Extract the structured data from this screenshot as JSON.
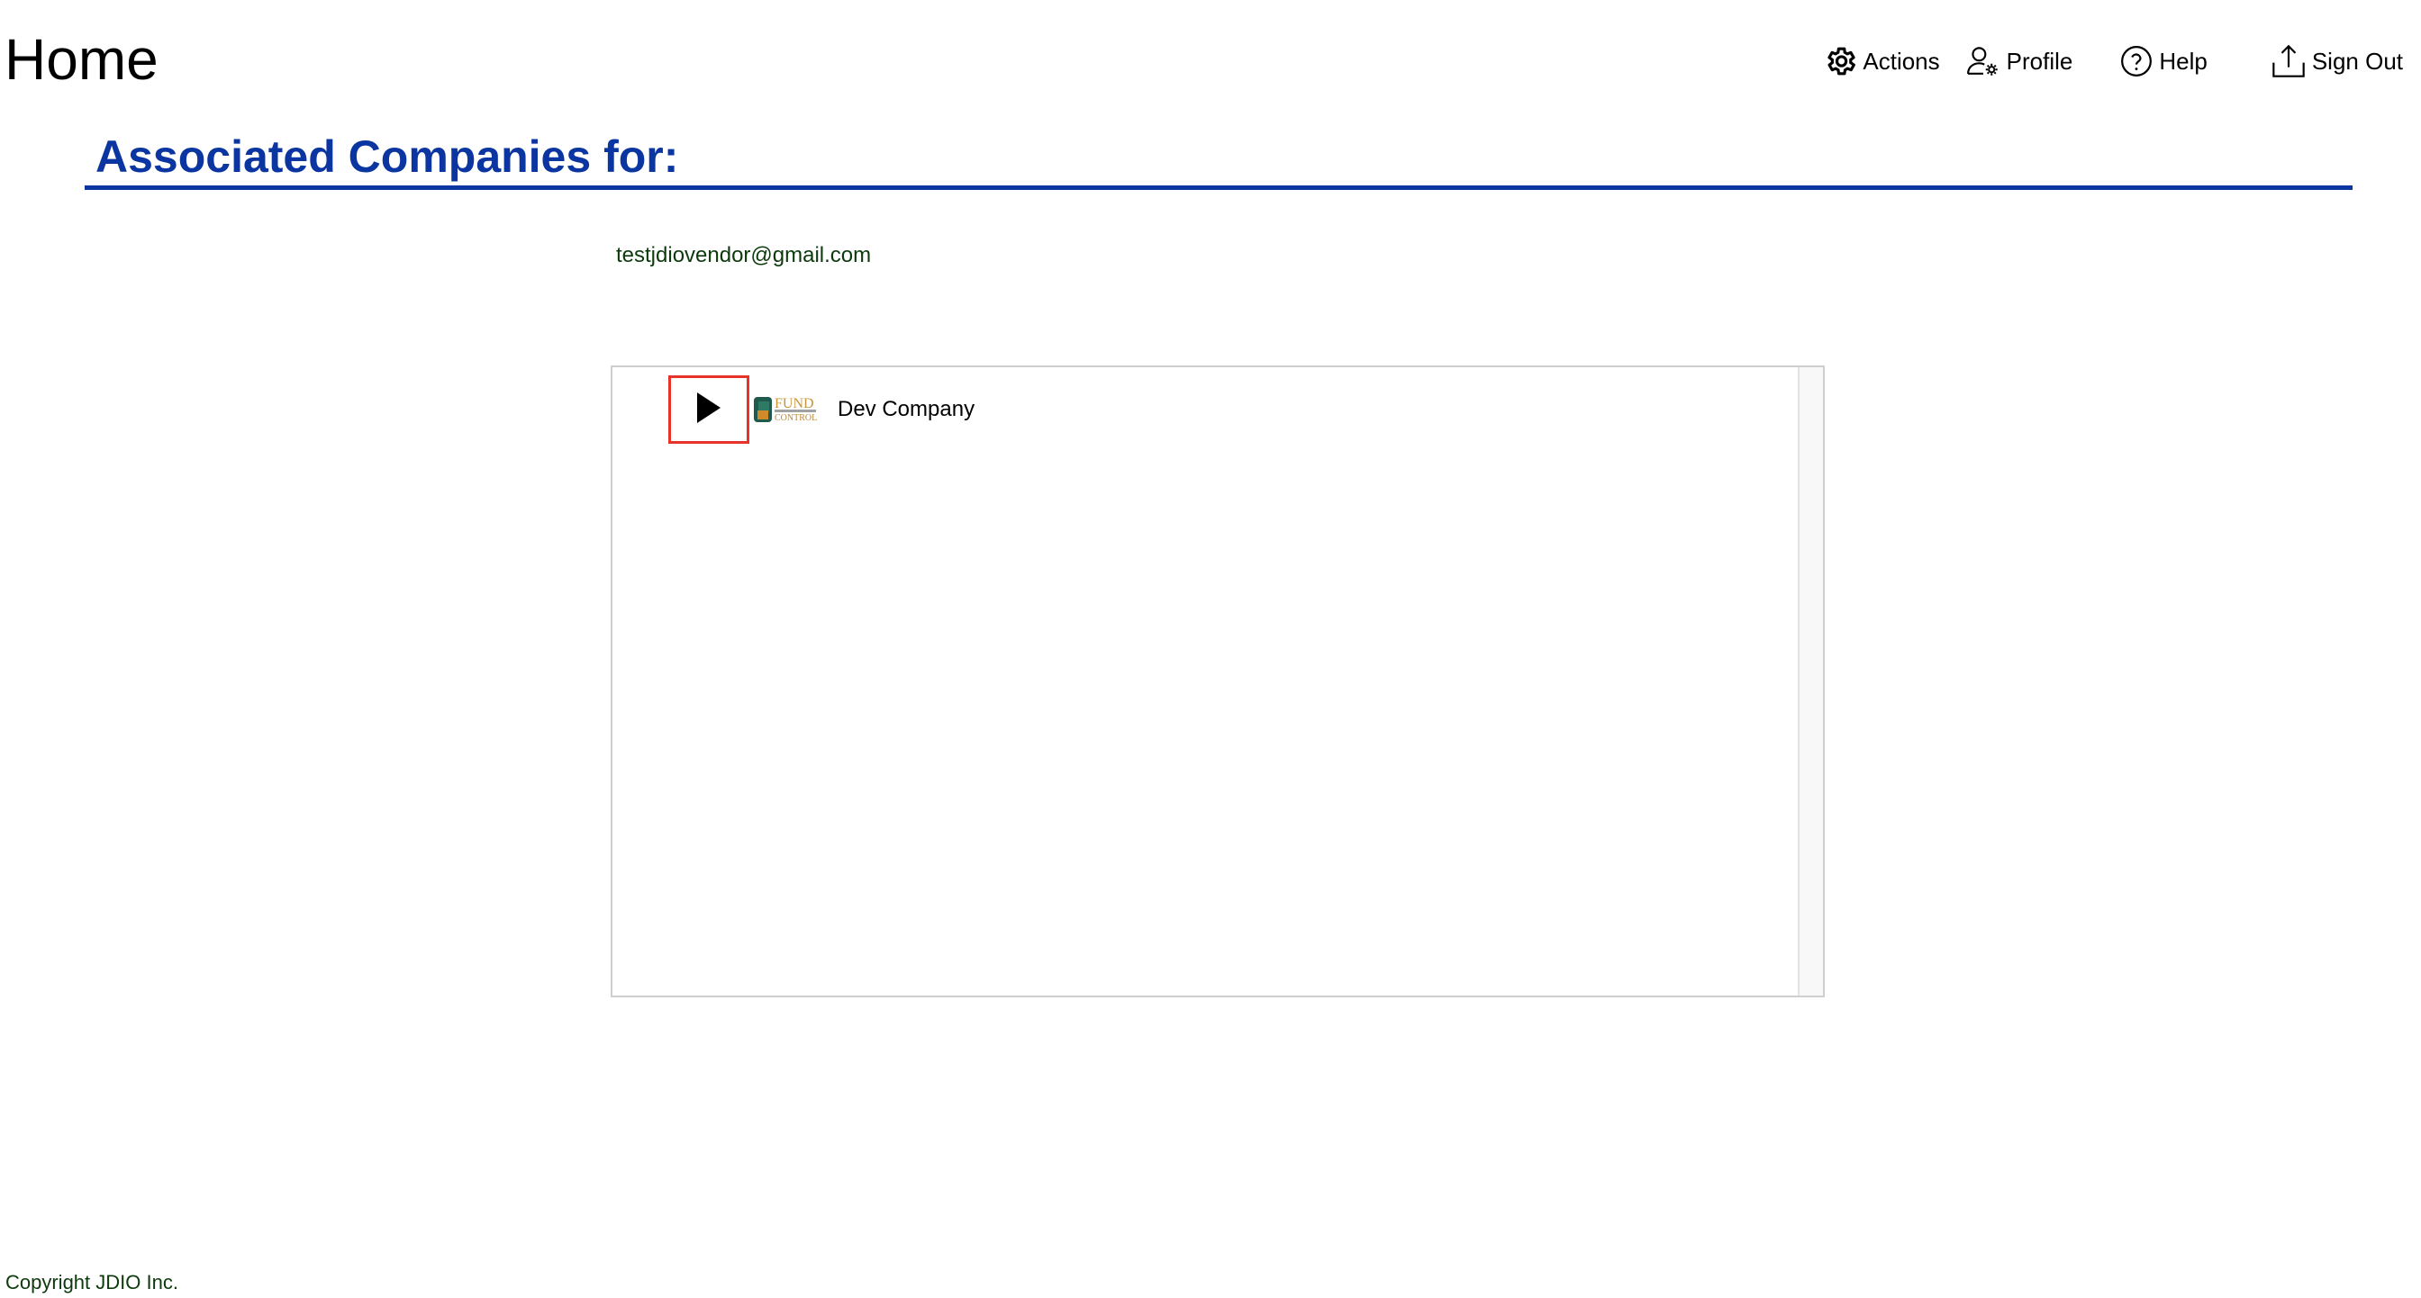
{
  "header": {
    "title": "Home"
  },
  "nav": {
    "actions": {
      "label": "Actions",
      "icon": "gear-icon"
    },
    "profile": {
      "label": "Profile",
      "icon": "user-settings-icon"
    },
    "help": {
      "label": "Help",
      "icon": "help-circle-icon"
    },
    "sign_out": {
      "label": "Sign Out",
      "icon": "upload-icon"
    }
  },
  "main": {
    "heading": "Associated Companies for:",
    "email": "testjdiovendor@gmail.com",
    "tree": {
      "items": [
        {
          "label": "Dev Company",
          "expanded": false,
          "logo_text": "FUND CONTROL"
        }
      ]
    }
  },
  "footer": {
    "copyright": "Copyright JDIO Inc."
  },
  "colors": {
    "heading_blue": "#0b35a0",
    "highlight_red": "#e8332a",
    "footer_green": "#0d3a0d"
  }
}
